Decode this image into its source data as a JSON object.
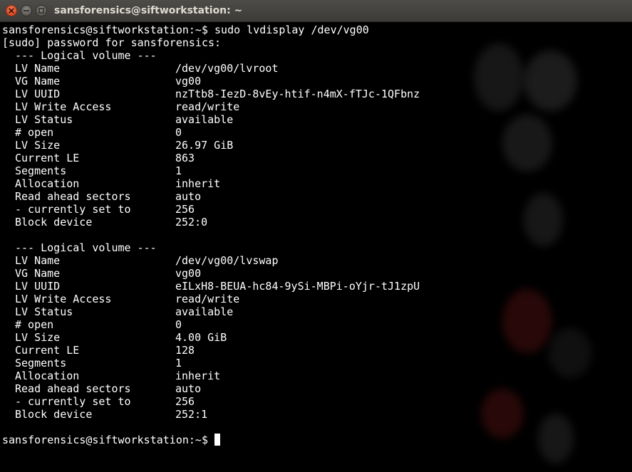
{
  "window": {
    "title": "sansforensics@siftworkstation: ~",
    "controls": [
      "close-icon",
      "minimize-icon",
      "maximize-icon"
    ],
    "colors": {
      "close": "#e0512a",
      "titlebar": "#3c3b37",
      "terminal_bg": "#000000",
      "text": "#ffffff"
    }
  },
  "terminal": {
    "command_line": "sansforensics@siftworkstation:~$ sudo lvdisplay /dev/vg00",
    "password_prompt": "[sudo] password for sansforensics:",
    "volumes": [
      {
        "header": "--- Logical volume ---",
        "rows": [
          {
            "key": "LV Name",
            "value": "/dev/vg00/lvroot"
          },
          {
            "key": "VG Name",
            "value": "vg00"
          },
          {
            "key": "LV UUID",
            "value": "nzTtb8-IezD-8vEy-htif-n4mX-fTJc-1QFbnz"
          },
          {
            "key": "LV Write Access",
            "value": "read/write"
          },
          {
            "key": "LV Status",
            "value": "available"
          },
          {
            "key": "# open",
            "value": "0"
          },
          {
            "key": "LV Size",
            "value": "26.97 GiB"
          },
          {
            "key": "Current LE",
            "value": "863"
          },
          {
            "key": "Segments",
            "value": "1"
          },
          {
            "key": "Allocation",
            "value": "inherit"
          },
          {
            "key": "Read ahead sectors",
            "value": "auto"
          },
          {
            "key": "- currently set to",
            "value": "256"
          },
          {
            "key": "Block device",
            "value": "252:0"
          }
        ]
      },
      {
        "header": "--- Logical volume ---",
        "rows": [
          {
            "key": "LV Name",
            "value": "/dev/vg00/lvswap"
          },
          {
            "key": "VG Name",
            "value": "vg00"
          },
          {
            "key": "LV UUID",
            "value": "eILxH8-BEUA-hc84-9ySi-MBPi-oYjr-tJ1zpU"
          },
          {
            "key": "LV Write Access",
            "value": "read/write"
          },
          {
            "key": "LV Status",
            "value": "available"
          },
          {
            "key": "# open",
            "value": "0"
          },
          {
            "key": "LV Size",
            "value": "4.00 GiB"
          },
          {
            "key": "Current LE",
            "value": "128"
          },
          {
            "key": "Segments",
            "value": "1"
          },
          {
            "key": "Allocation",
            "value": "inherit"
          },
          {
            "key": "Read ahead sectors",
            "value": "auto"
          },
          {
            "key": "- currently set to",
            "value": "256"
          },
          {
            "key": "Block device",
            "value": "252:1"
          }
        ]
      }
    ],
    "final_prompt": "sansforensics@siftworkstation:~$"
  }
}
